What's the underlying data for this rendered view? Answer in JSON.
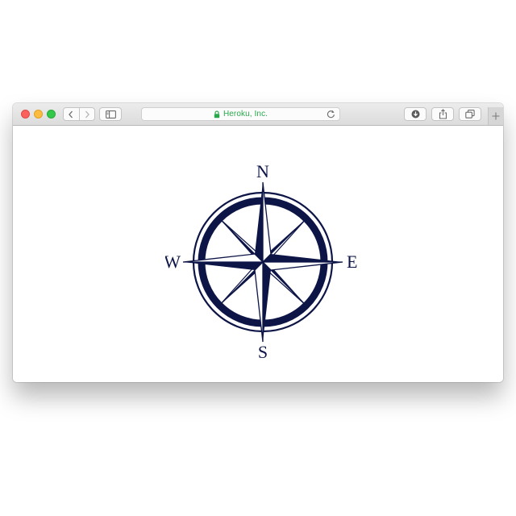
{
  "browser": {
    "address_bar": {
      "site_label": "Heroku, Inc.",
      "site_color": "#29a84b",
      "secure_icon": "lock-icon",
      "reload_icon": "reload-icon"
    },
    "toolbar": {
      "back_icon": "chevron-left-icon",
      "forward_icon": "chevron-right-icon",
      "sidebar_icon": "sidebar-icon",
      "download_icon": "download-icon",
      "share_icon": "share-icon",
      "tabs_icon": "tabs-overview-icon",
      "new_tab_icon": "plus-icon"
    },
    "traffic_lights": {
      "close_color": "#fc605c",
      "minimize_color": "#fdbc40",
      "zoom_color": "#34c84a"
    }
  },
  "page": {
    "compass": {
      "north": "N",
      "south": "S",
      "east": "E",
      "west": "W",
      "color": "#0d1547"
    }
  }
}
